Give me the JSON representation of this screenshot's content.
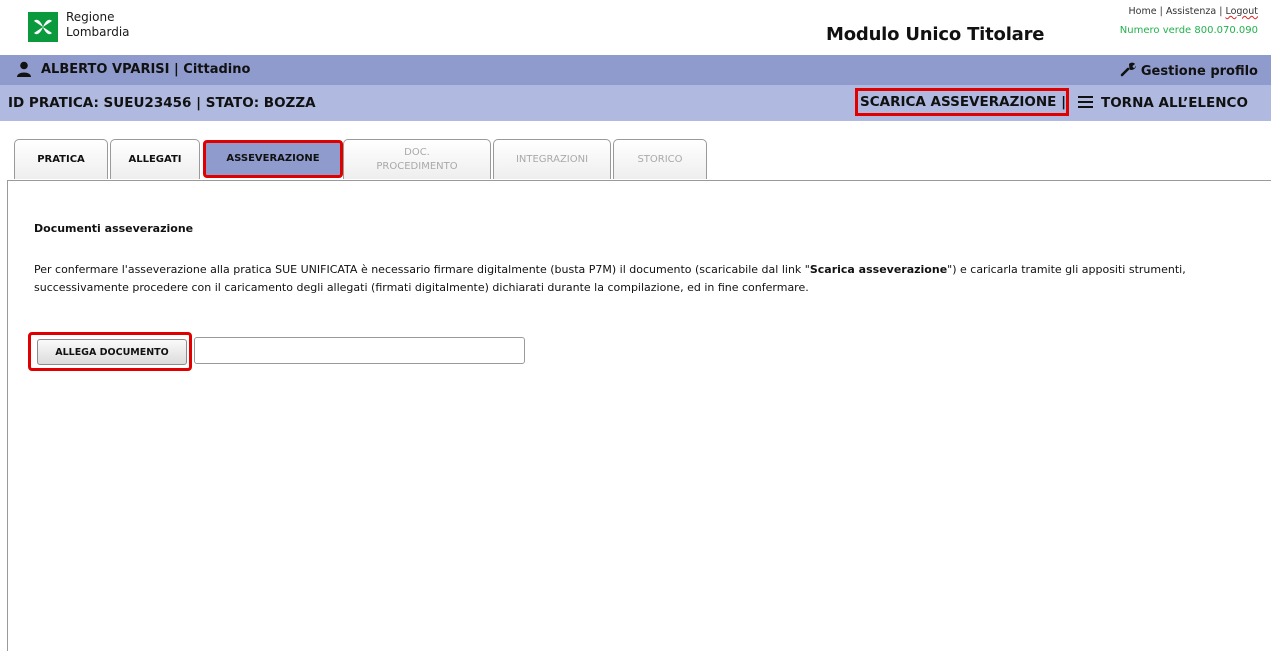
{
  "brand": {
    "line1": "Regione",
    "line2": "Lombardia",
    "color": "#0a9a3d"
  },
  "header": {
    "title": "Modulo Unico Titolare",
    "links": {
      "home": "Home",
      "help": "Assistenza",
      "logout": "Logout"
    },
    "separator": "|",
    "hotline": "Numero verde 800.070.090"
  },
  "userbar": {
    "user": "ALBERTO VPARISI | Cittadino",
    "profile_label": "Gestione profilo",
    "color": "#8f9bcc"
  },
  "pracbar": {
    "id_status": "ID PRATICA: SUEU23456  | STATO: BOZZA",
    "download_label": "SCARICA ASSEVERAZIONE  |",
    "back_label": "TORNA ALL’ELENCO",
    "color": "#b0b9e0"
  },
  "tabs": [
    {
      "label": "PRATICA",
      "state": "enabled"
    },
    {
      "label": "ALLEGATI",
      "state": "enabled"
    },
    {
      "label": "ASSEVERAZIONE",
      "state": "active"
    },
    {
      "label": "DOC.",
      "label2": "PROCEDIMENTO",
      "state": "disabled"
    },
    {
      "label": "INTEGRAZIONI",
      "state": "disabled"
    },
    {
      "label": "STORICO",
      "state": "disabled"
    }
  ],
  "content": {
    "section_title": "Documenti asseverazione",
    "desc_part1": "Per confermare l'asseverazione alla pratica SUE UNIFICATA è necessario firmare digitalmente (busta P7M) il documento (scaricabile dal link \"",
    "desc_bold": "Scarica asseverazione",
    "desc_part2": "\") e caricarla tramite gli appositi strumenti, successivamente procedere con il caricamento degli allegati (firmati digitalmente) dichiarati durante la compilazione, ed in fine confermare.",
    "attach_label": "ALLEGA DOCUMENTO",
    "file_value": ""
  },
  "highlight_color": "#e00000",
  "icons": [
    "regione-logo-icon",
    "user-icon",
    "wrench-icon",
    "list-icon"
  ]
}
